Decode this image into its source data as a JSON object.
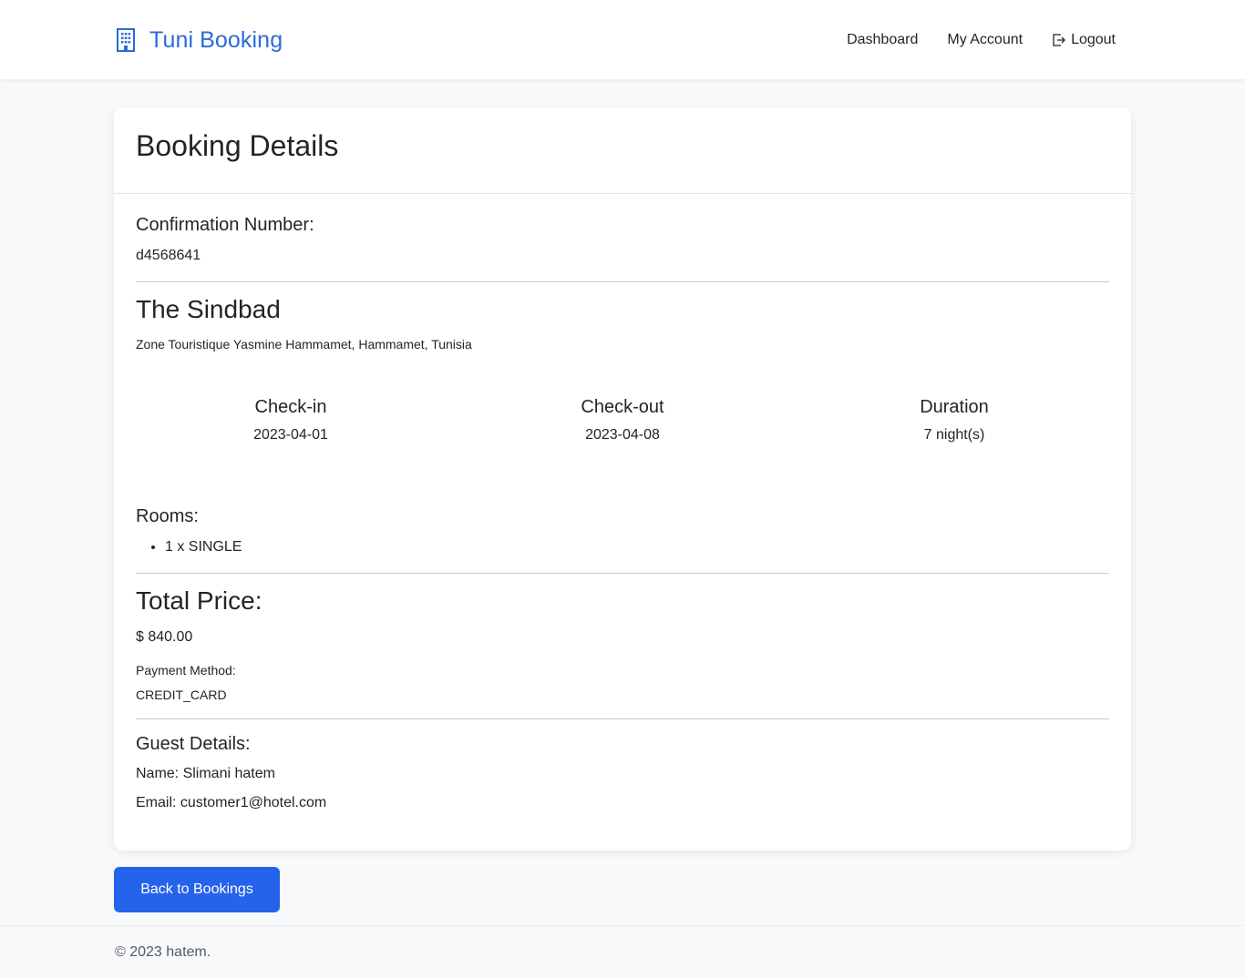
{
  "brand": {
    "name": "Tuni Booking",
    "icon": "building-icon",
    "color": "#2a6bd8"
  },
  "nav": {
    "dashboard": "Dashboard",
    "my_account": "My Account",
    "logout": "Logout",
    "logout_icon": "logout-icon"
  },
  "page": {
    "title": "Booking Details"
  },
  "confirmation": {
    "label": "Confirmation Number:",
    "value": "d4568641"
  },
  "hotel": {
    "name": "The Sindbad",
    "address": "Zone Touristique Yasmine Hammamet, Hammamet, Tunisia"
  },
  "stay": {
    "checkin_label": "Check-in",
    "checkin_value": "2023-04-01",
    "checkout_label": "Check-out",
    "checkout_value": "2023-04-08",
    "duration_label": "Duration",
    "duration_value": "7 night(s)"
  },
  "rooms": {
    "label": "Rooms:",
    "items": [
      "1 x SINGLE"
    ]
  },
  "price": {
    "label": "Total Price:",
    "value": "$ 840.00",
    "payment_label": "Payment Method:",
    "payment_value": "CREDIT_CARD"
  },
  "guest": {
    "label": "Guest Details:",
    "name": "Name: Slimani hatem",
    "email": "Email: customer1@hotel.com"
  },
  "actions": {
    "back": "Back to Bookings",
    "accent": "#2563eb"
  },
  "footer": {
    "text": "© 2023 hatem."
  }
}
